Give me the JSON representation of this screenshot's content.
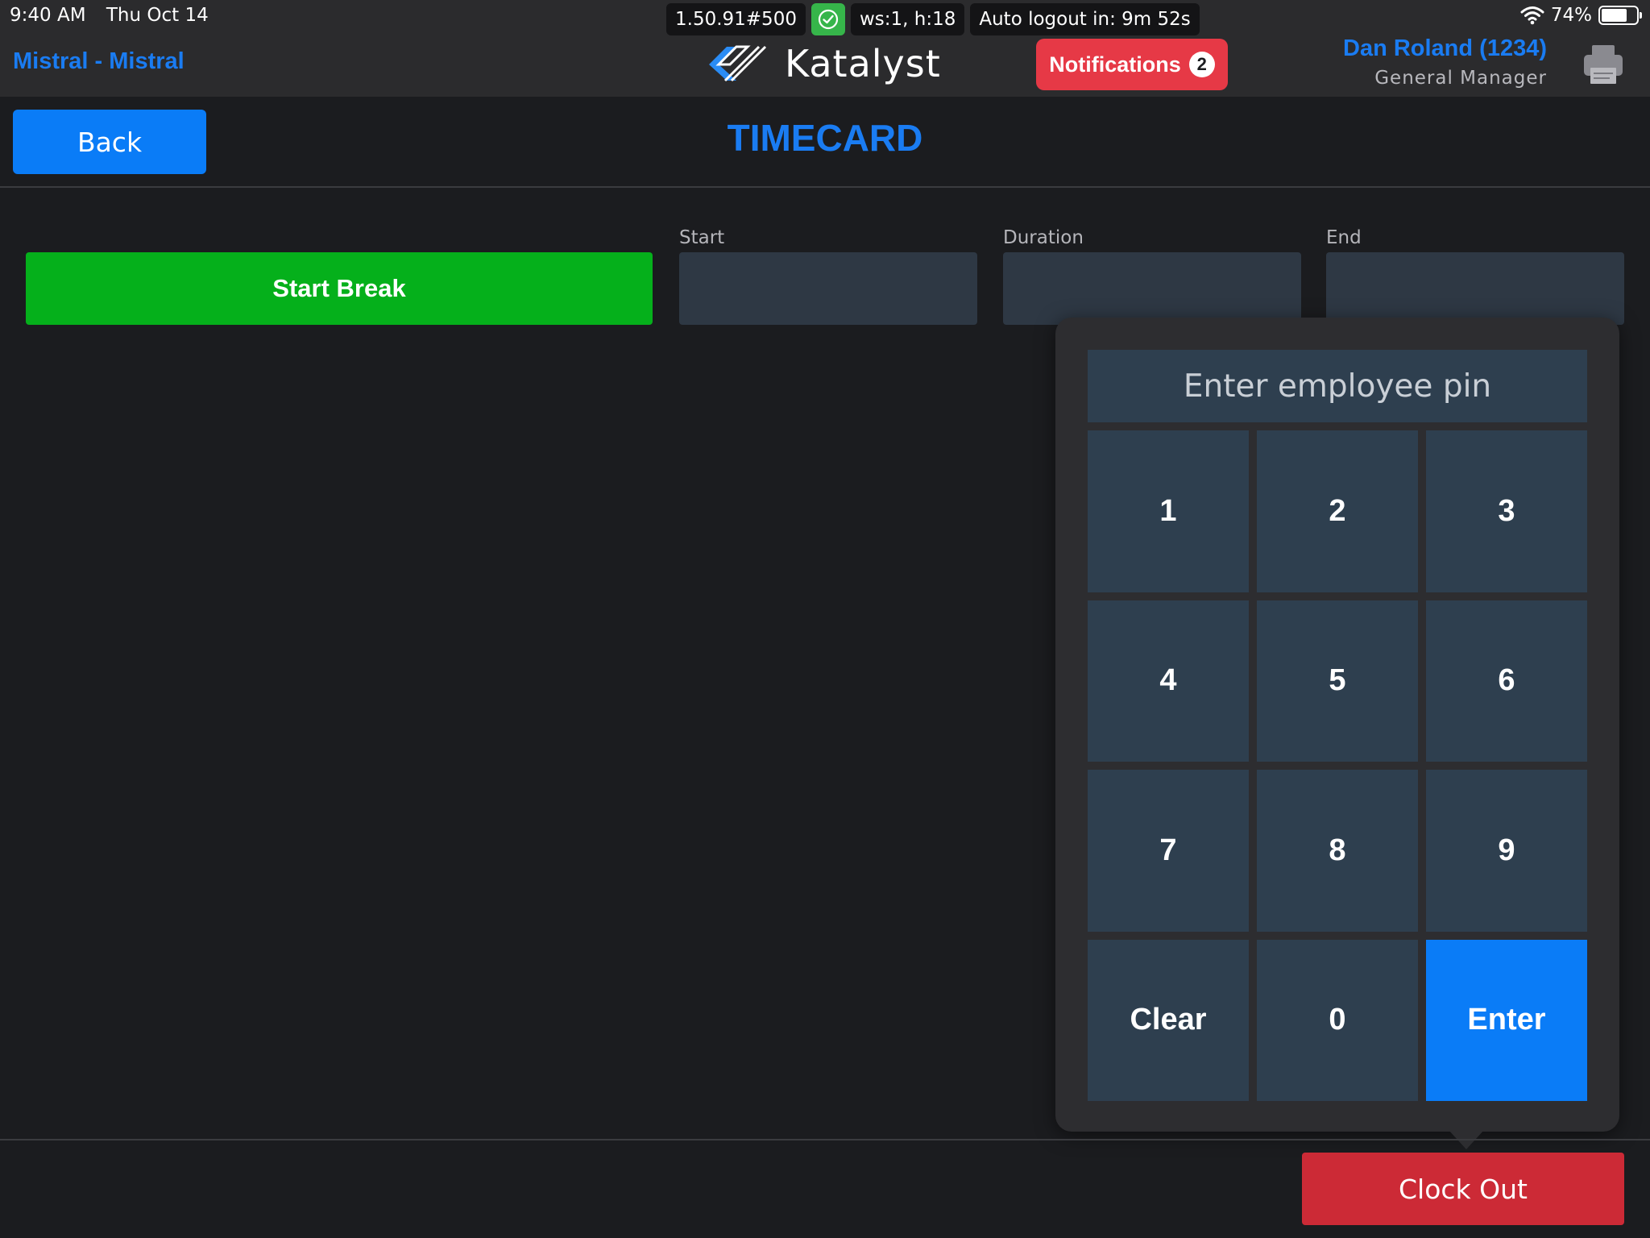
{
  "status_bar": {
    "time": "9:40 AM",
    "date": "Thu Oct 14",
    "build": "1.50.91#500",
    "ws_info": "ws:1, h:18",
    "auto_logout": "Auto logout in: 9m 52s",
    "battery": "74%",
    "battery_level": 0.74,
    "sync_icon": "check-circle-icon"
  },
  "header": {
    "store": "Mistral - Mistral",
    "brand": "Katalyst",
    "notifications_label": "Notifications",
    "notifications_count": "2",
    "user_name": "Dan Roland (1234)",
    "user_role": "General Manager",
    "printer_icon": "printer-icon"
  },
  "page": {
    "back_label": "Back",
    "title": "TIMECARD"
  },
  "break_row": {
    "start_break_label": "Start Break",
    "start_label": "Start",
    "duration_label": "Duration",
    "end_label": "End",
    "start_value": "",
    "duration_value": "",
    "end_value": ""
  },
  "pin_pad": {
    "placeholder": "Enter employee pin",
    "keys": [
      "1",
      "2",
      "3",
      "4",
      "5",
      "6",
      "7",
      "8",
      "9",
      "Clear",
      "0",
      "Enter"
    ]
  },
  "footer": {
    "clock_out_label": "Clock Out"
  },
  "colors": {
    "accent_blue": "#1a7cf2",
    "button_blue": "#0a7cf7",
    "green": "#05b01b",
    "red": "#cc2a36",
    "notification_red": "#e63946",
    "field_bg": "#2e3f4f"
  }
}
